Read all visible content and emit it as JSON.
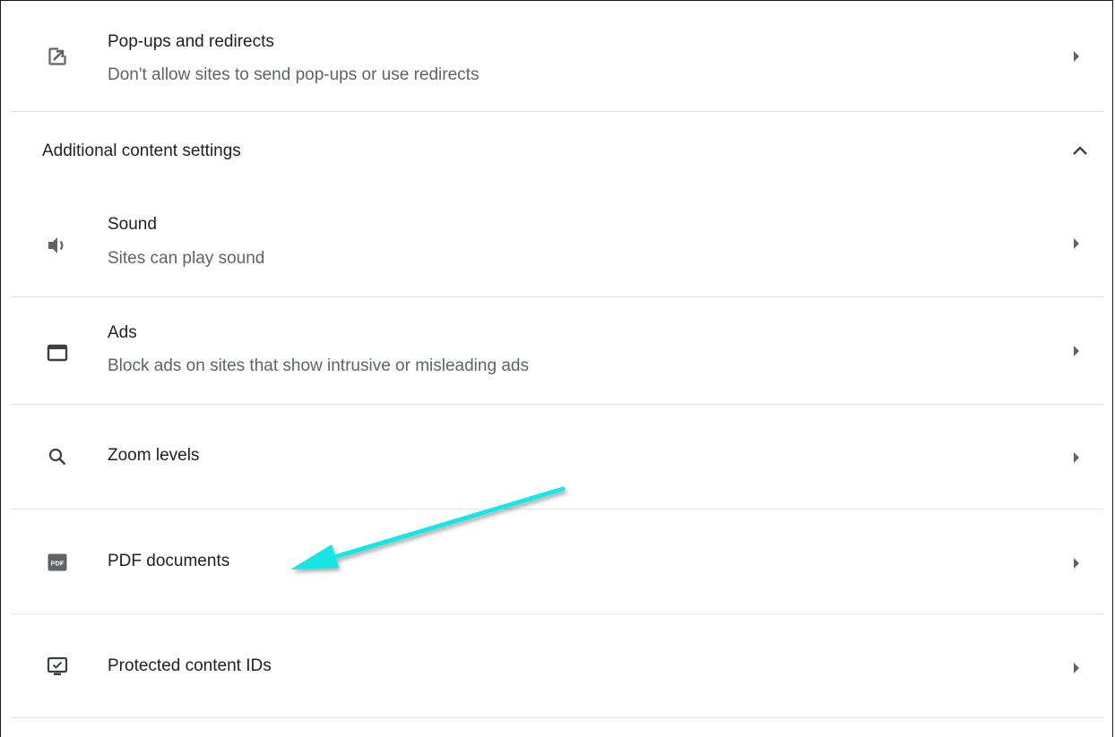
{
  "rows_top": {
    "popups": {
      "title": "Pop-ups and redirects",
      "subtitle": "Don't allow sites to send pop-ups or use redirects",
      "icon": "open-in-new-icon"
    }
  },
  "section": {
    "label": "Additional content settings",
    "expanded": true,
    "icon": "chevron-up-icon"
  },
  "items": {
    "sound": {
      "title": "Sound",
      "subtitle": "Sites can play sound",
      "icon": "volume-icon"
    },
    "ads": {
      "title": "Ads",
      "subtitle": "Block ads on sites that show intrusive or misleading ads",
      "icon": "ads-window-icon"
    },
    "zoom": {
      "title": "Zoom levels",
      "icon": "search-icon"
    },
    "pdf": {
      "title": "PDF documents",
      "icon_text": "PDF",
      "icon": "pdf-icon"
    },
    "protected": {
      "title": "Protected content IDs",
      "icon": "protected-content-icon"
    }
  },
  "annotation": {
    "type": "arrow",
    "color": "#19e6e6",
    "points_to": "PDF documents"
  },
  "colors": {
    "text_primary": "#202124",
    "text_secondary": "#5f6368",
    "icon": "#5f6368",
    "divider": "#e4e4e4"
  }
}
